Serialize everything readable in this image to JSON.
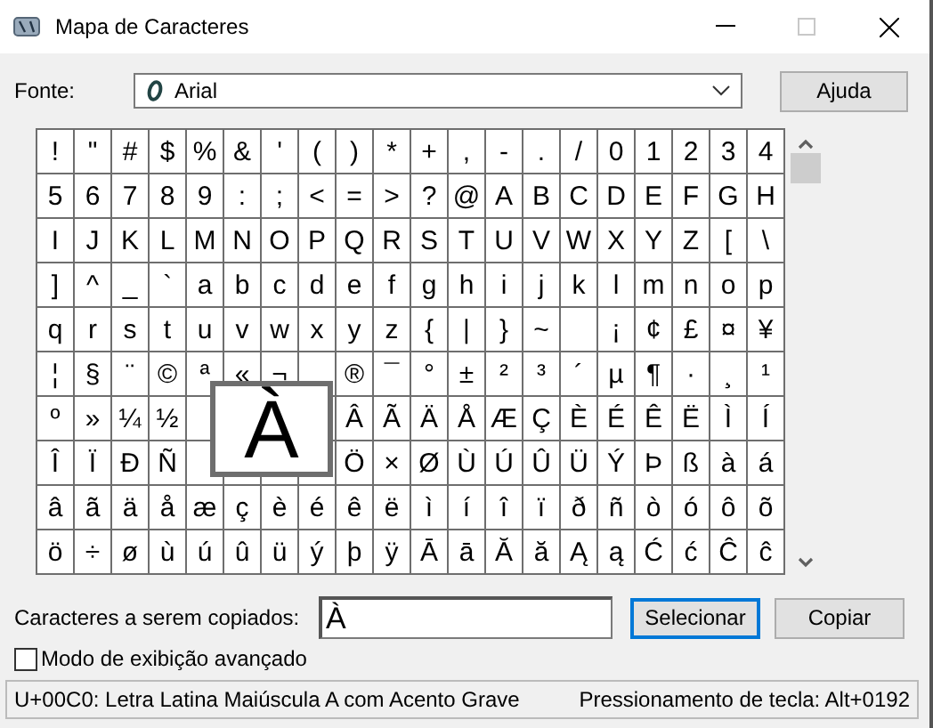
{
  "window": {
    "title": "Mapa de Caracteres"
  },
  "font": {
    "label": "Fonte:",
    "value": "Arial"
  },
  "help_button": "Ajuda",
  "grid": {
    "rows": [
      [
        "!",
        "\"",
        "#",
        "$",
        "%",
        "&",
        "'",
        "(",
        ")",
        "*",
        "+",
        ",",
        "-",
        ".",
        "/",
        "0",
        "1",
        "2",
        "3",
        "4"
      ],
      [
        "5",
        "6",
        "7",
        "8",
        "9",
        ":",
        ";",
        "<",
        "=",
        ">",
        "?",
        "@",
        "A",
        "B",
        "C",
        "D",
        "E",
        "F",
        "G",
        "H"
      ],
      [
        "I",
        "J",
        "K",
        "L",
        "M",
        "N",
        "O",
        "P",
        "Q",
        "R",
        "S",
        "T",
        "U",
        "V",
        "W",
        "X",
        "Y",
        "Z",
        "[",
        "\\"
      ],
      [
        "]",
        "^",
        "_",
        "`",
        "a",
        "b",
        "c",
        "d",
        "e",
        "f",
        "g",
        "h",
        "i",
        "j",
        "k",
        "l",
        "m",
        "n",
        "o",
        "p"
      ],
      [
        "q",
        "r",
        "s",
        "t",
        "u",
        "v",
        "w",
        "x",
        "y",
        "z",
        "{",
        "|",
        "}",
        "~",
        null,
        "¡",
        "¢",
        "£",
        "¤",
        "¥"
      ],
      [
        "¦",
        "§",
        "¨",
        "©",
        "ª",
        "«",
        "¬",
        null,
        "®",
        "¯",
        "°",
        "±",
        "²",
        "³",
        "´",
        "µ",
        "¶",
        "·",
        "¸",
        "¹"
      ],
      [
        "º",
        "»",
        "¼",
        "½",
        null,
        null,
        null,
        null,
        "Â",
        "Ã",
        "Ä",
        "Å",
        "Æ",
        "Ç",
        "È",
        "É",
        "Ê",
        "Ë",
        "Ì",
        "Í"
      ],
      [
        "Î",
        "Ï",
        "Ð",
        "Ñ",
        null,
        null,
        null,
        null,
        "Ö",
        "×",
        "Ø",
        "Ù",
        "Ú",
        "Û",
        "Ü",
        "Ý",
        "Þ",
        "ß",
        "à",
        "á"
      ],
      [
        "â",
        "ã",
        "ä",
        "å",
        "æ",
        "ç",
        "è",
        "é",
        "ê",
        "ë",
        "ì",
        "í",
        "î",
        "ï",
        "ð",
        "ñ",
        "ò",
        "ó",
        "ô",
        "õ"
      ],
      [
        "ö",
        "÷",
        "ø",
        "ù",
        "ú",
        "û",
        "ü",
        "ý",
        "þ",
        "ÿ",
        "Ā",
        "ā",
        "Ă",
        "ă",
        "Ą",
        "ą",
        "Ć",
        "ć",
        "Ĉ",
        "ĉ"
      ]
    ],
    "magnified": "À"
  },
  "copy": {
    "label": "Caracteres a serem copiados:",
    "value": "À"
  },
  "buttons": [
    {
      "label": "Selecionar",
      "focused": true
    },
    {
      "label": "Copiar",
      "focused": false
    }
  ],
  "advanced": {
    "label": "Modo de exibição avançado",
    "checked": false
  },
  "status_bar": {
    "description": "U+00C0: Letra Latina Maiúscula A com Acento Grave",
    "keystroke": "Pressionamento de tecla: Alt+0192"
  }
}
